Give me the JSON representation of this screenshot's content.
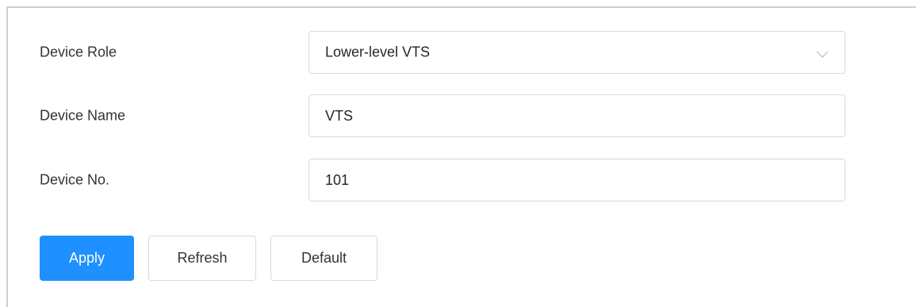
{
  "form": {
    "device_role": {
      "label": "Device Role",
      "value": "Lower-level VTS",
      "icon": "chevron-down-icon"
    },
    "device_name": {
      "label": "Device Name",
      "value": "VTS"
    },
    "device_no": {
      "label": "Device No.",
      "value": "101"
    }
  },
  "buttons": {
    "apply": "Apply",
    "refresh": "Refresh",
    "default": "Default"
  },
  "colors": {
    "primary": "#1e90ff",
    "border": "#d9d9d9",
    "text": "#333333"
  }
}
